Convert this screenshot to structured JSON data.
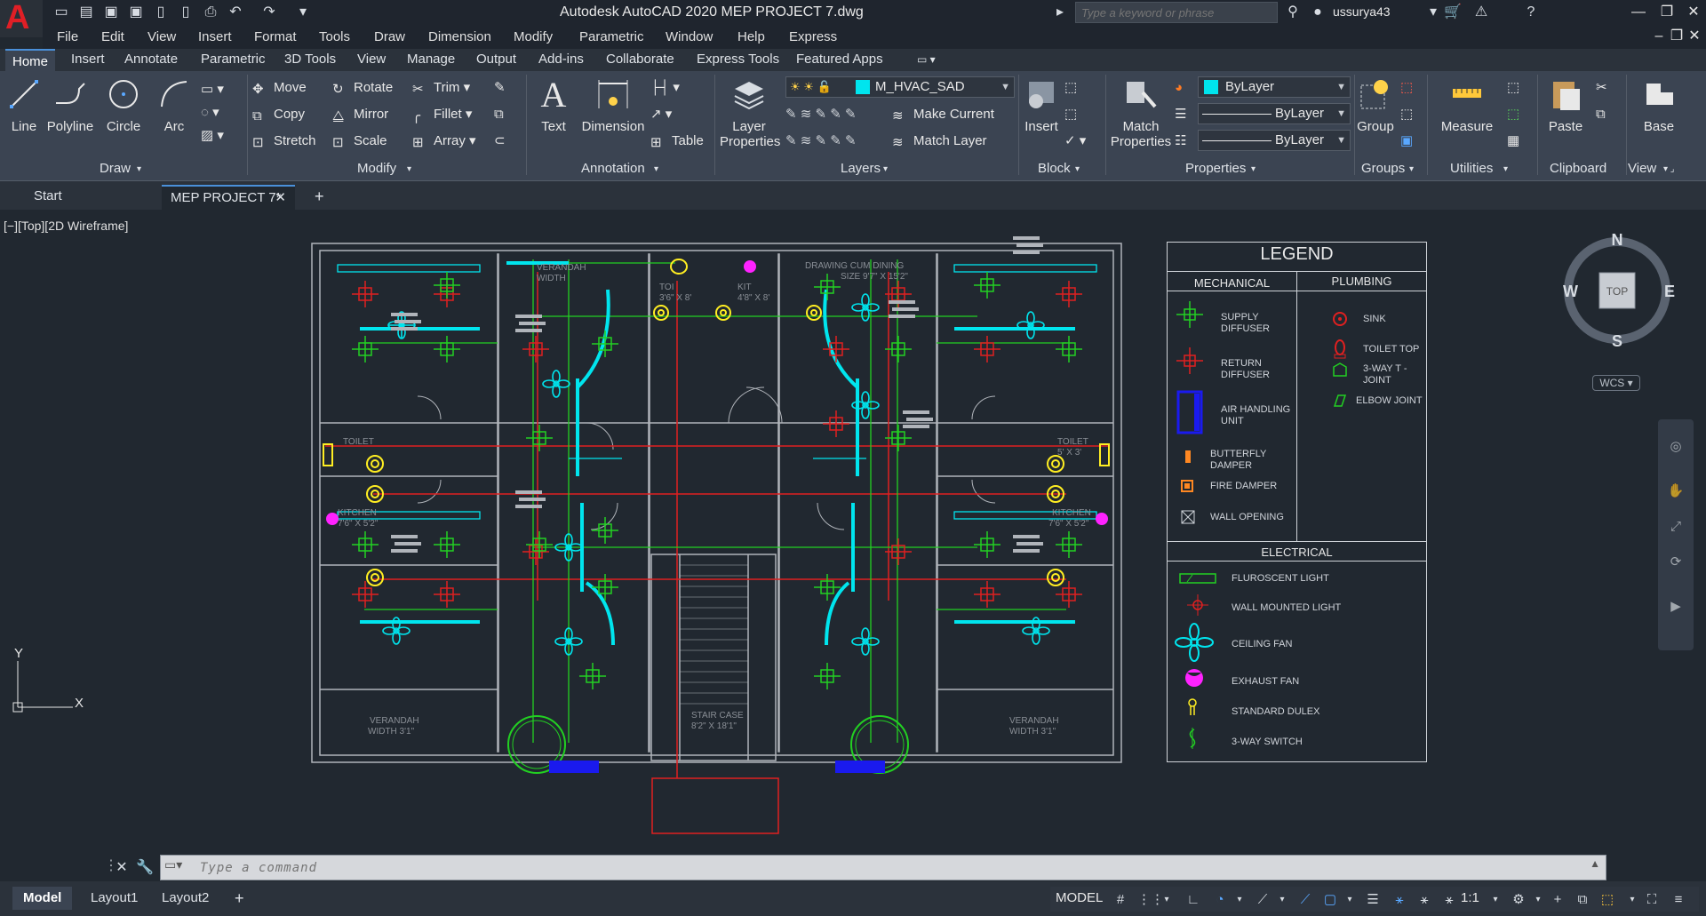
{
  "titlebar": {
    "title": "Autodesk AutoCAD 2020    MEP PROJECT 7.dwg",
    "search_placeholder": "Type a keyword or phrase",
    "user": "ussurya43"
  },
  "menu": [
    "File",
    "Edit",
    "View",
    "Insert",
    "Format",
    "Tools",
    "Draw",
    "Dimension",
    "Modify",
    "Parametric",
    "Window",
    "Help",
    "Express"
  ],
  "ribbon_tabs": [
    "Home",
    "Insert",
    "Annotate",
    "Parametric",
    "3D Tools",
    "View",
    "Manage",
    "Output",
    "Add-ins",
    "Collaborate",
    "Express Tools",
    "Featured Apps"
  ],
  "ribbon": {
    "draw": {
      "title": "Draw",
      "line": "Line",
      "polyline": "Polyline",
      "circle": "Circle",
      "arc": "Arc"
    },
    "modify": {
      "title": "Modify",
      "move": "Move",
      "rotate": "Rotate",
      "trim": "Trim",
      "copy": "Copy",
      "mirror": "Mirror",
      "fillet": "Fillet",
      "stretch": "Stretch",
      "scale": "Scale",
      "array": "Array"
    },
    "annotation": {
      "title": "Annotation",
      "text": "Text",
      "dimension": "Dimension",
      "table": "Table"
    },
    "layers": {
      "title": "Layers",
      "layer_properties_1": "Layer",
      "layer_properties_2": "Properties",
      "current_layer": "M_HVAC_SAD",
      "make_current": "Make Current",
      "match_layer": "Match Layer"
    },
    "block": {
      "title": "Block",
      "insert": "Insert"
    },
    "properties": {
      "title": "Properties",
      "match_1": "Match",
      "match_2": "Properties",
      "color": "ByLayer",
      "linetype": "ByLayer",
      "lineweight": "ByLayer"
    },
    "groups": {
      "title": "Groups",
      "group": "Group"
    },
    "utilities": {
      "title": "Utilities",
      "measure": "Measure"
    },
    "clipboard": {
      "title": "Clipboard",
      "paste": "Paste"
    },
    "view": {
      "title": "View",
      "base": "Base"
    }
  },
  "doc_tabs": {
    "start": "Start",
    "active": "MEP PROJECT 7*"
  },
  "viewport_label": "[−][Top][2D Wireframe]",
  "plan_labels": {
    "verandah_top": "VERANDAH",
    "verandah_top_2": "WIDTH",
    "toi": "TOI",
    "toi_size": "3'6\" X 8'",
    "kit": "KIT",
    "kit_size": "4'8\" X 8'",
    "drawing_dining": "DRAWING CUM DINING",
    "drawing_size": "SIZE 9'7\" X 15'2\"",
    "toilet_left": "TOILET",
    "toilet_right": "TOILET",
    "toilet_right_size": "5' X 3'",
    "kitchen_left": "KITCHEN",
    "kitchen_left_size": "7'6\" X 5'2\"",
    "kitchen_right": "KITCHEN",
    "kitchen_right_size": "7'6\" X 5'2\"",
    "verandah_left": "VERANDAH",
    "verandah_left_size": "WIDTH 3'1\"",
    "verandah_right": "VERANDAH",
    "verandah_right_size": "WIDTH 3'1\"",
    "stair": "STAIR CASE",
    "stair_size": "8'2\" X 18'1\""
  },
  "legend": {
    "title": "LEGEND",
    "mechanical": "MECHANICAL",
    "plumbing": "PLUMBING",
    "electrical": "ELECTRICAL",
    "mech_items": [
      "SUPPLY DIFFUSER",
      "RETURN DIFFUSER",
      "AIR HANDLING UNIT",
      "BUTTERFLY DAMPER",
      "FIRE DAMPER",
      "WALL OPENING"
    ],
    "plumb_items": [
      "SINK",
      "TOILET TOP",
      "3-WAY T - JOINT",
      "ELBOW JOINT"
    ],
    "elec_items": [
      "FLUROSCENT LIGHT",
      "WALL MOUNTED LIGHT",
      "CEILING FAN",
      "EXHAUST FAN",
      "STANDARD DULEX",
      "3-WAY SWITCH"
    ]
  },
  "viewcube": {
    "n": "N",
    "s": "S",
    "e": "E",
    "w": "W",
    "top": "TOP",
    "wcs": "WCS"
  },
  "ucs": {
    "x": "X",
    "y": "Y"
  },
  "command": {
    "placeholder": "Type a command"
  },
  "layout_tabs": [
    "Model",
    "Layout1",
    "Layout2"
  ],
  "status": {
    "model": "MODEL",
    "scale": "1:1"
  },
  "colors": {
    "supply": "#22d022",
    "return": "#e02020",
    "duct": "#00e5ee",
    "plumbing": "#ffee22",
    "exhaust": "#ff22ff",
    "ahu": "#1a1aee",
    "wall": "#b0b4ba"
  }
}
